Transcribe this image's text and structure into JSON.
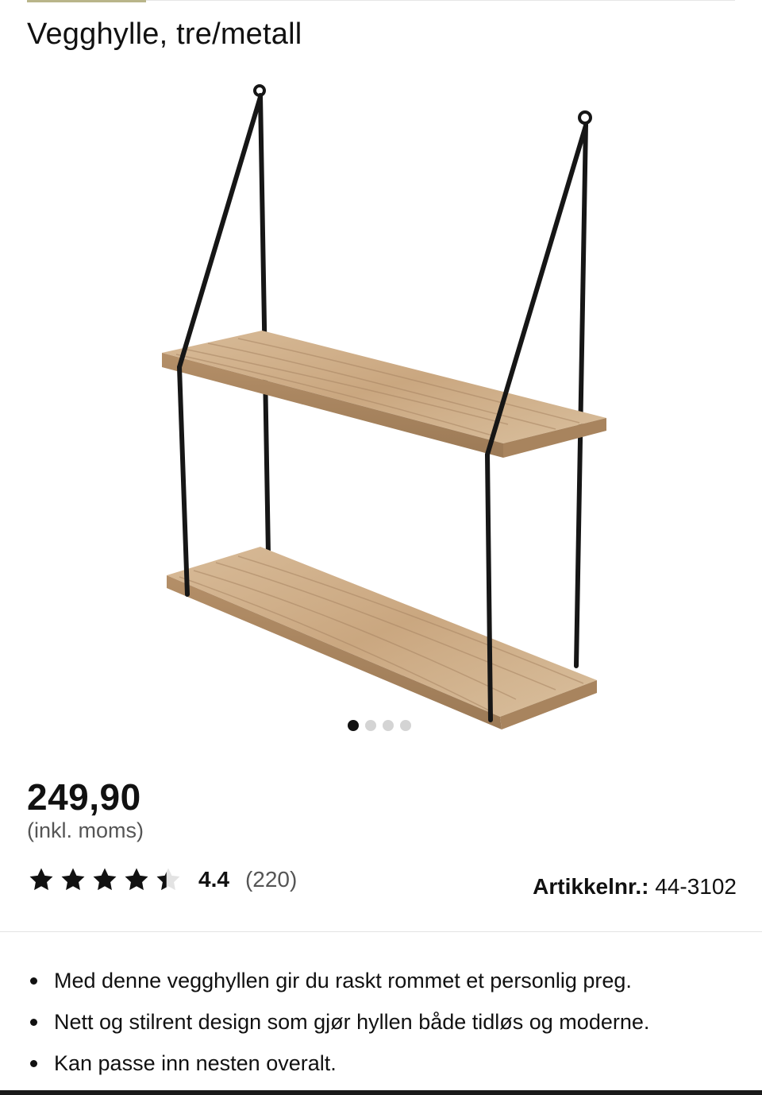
{
  "product": {
    "title": "Vegghylle, tre/metall",
    "image_alt": "Vegghylle",
    "gallery": {
      "slide_count": 4,
      "active_index": 0
    },
    "price": "249,90",
    "vat_note": "(inkl. moms)",
    "rating": {
      "stars": 4.4,
      "value_text": "4.4",
      "count_text": "(220)",
      "star_icon": "star-icon"
    },
    "article": {
      "label": "Artikkelnr.:",
      "number": "44-3102"
    },
    "bullets": [
      "Med denne vegghyllen gir du raskt rommet et personlig preg.",
      "Nett og stilrent design som gjør hyllen både tidløs og moderne.",
      "Kan passe inn nesten overalt."
    ]
  },
  "colors": {
    "text": "#111111",
    "muted": "#555555",
    "wood": "#c9a882",
    "metal": "#161616",
    "accent": "#b9b58a"
  }
}
